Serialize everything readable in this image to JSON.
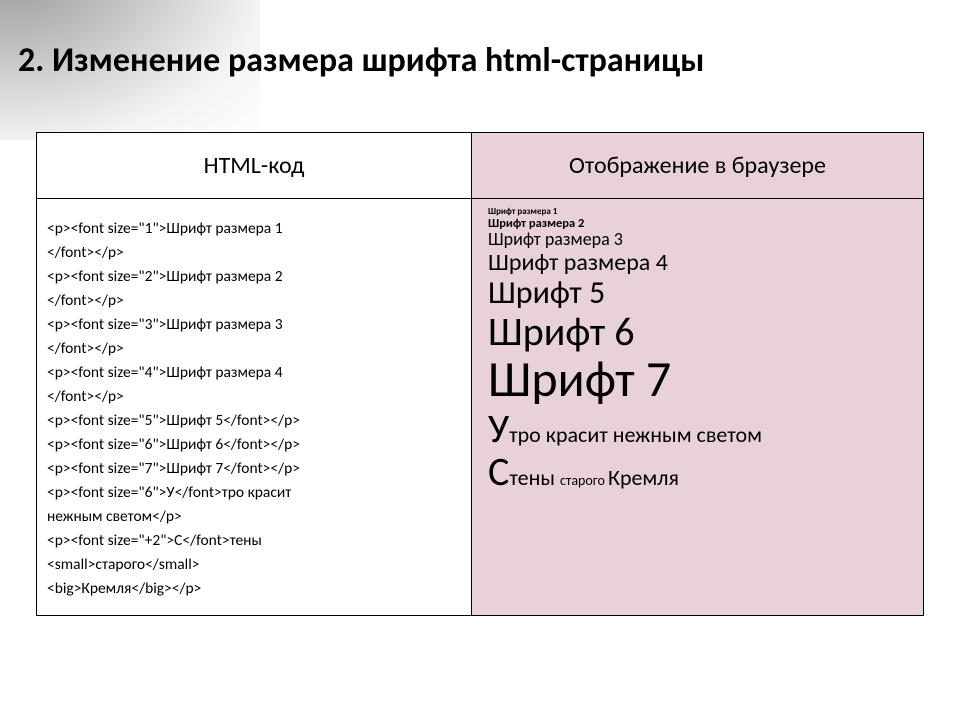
{
  "title": "2. Изменение размера шрифта html-страницы",
  "headers": {
    "code": "HTML-код",
    "render": "Отображение в браузере"
  },
  "code_lines": [
    "<p><font size=\"1\">Шрифт размера 1",
    "</font></p>",
    "<p><font size=\"2\">Шрифт размера 2",
    "</font></p>",
    "<p><font size=\"3\">Шрифт размера 3",
    "</font></p>",
    "<p><font size=\"4\">Шрифт размера 4",
    "</font></p>",
    "<p><font size=\"5\">Шрифт 5</font></p>",
    "<p><font size=\"6\">Шрифт 6</font></p>",
    "<p><font size=\"7\">Шрифт 7</font></p>",
    "<p><font size=\"6\">У</font>тро красит",
    "нежным светом</p>",
    "<p><font size=\"+2\">С</font>тены",
    "<small>старого</small>",
    "<big>Кремля</big></p>"
  ],
  "render": {
    "s1": "Шрифт размера 1",
    "s2": "Шрифт размера  2",
    "s3": "Шрифт размера 3",
    "s4": "Шрифт размера 4",
    "s5": "Шрифт 5",
    "s6": "Шрифт 6",
    "s7": "Шрифт 7",
    "poem1_cap": "У",
    "poem1_rest": "тро красит нежным светом",
    "poem2_cap": "С",
    "poem2_a": "тены ",
    "poem2_small": "старого ",
    "poem2_big": "Кремля"
  }
}
